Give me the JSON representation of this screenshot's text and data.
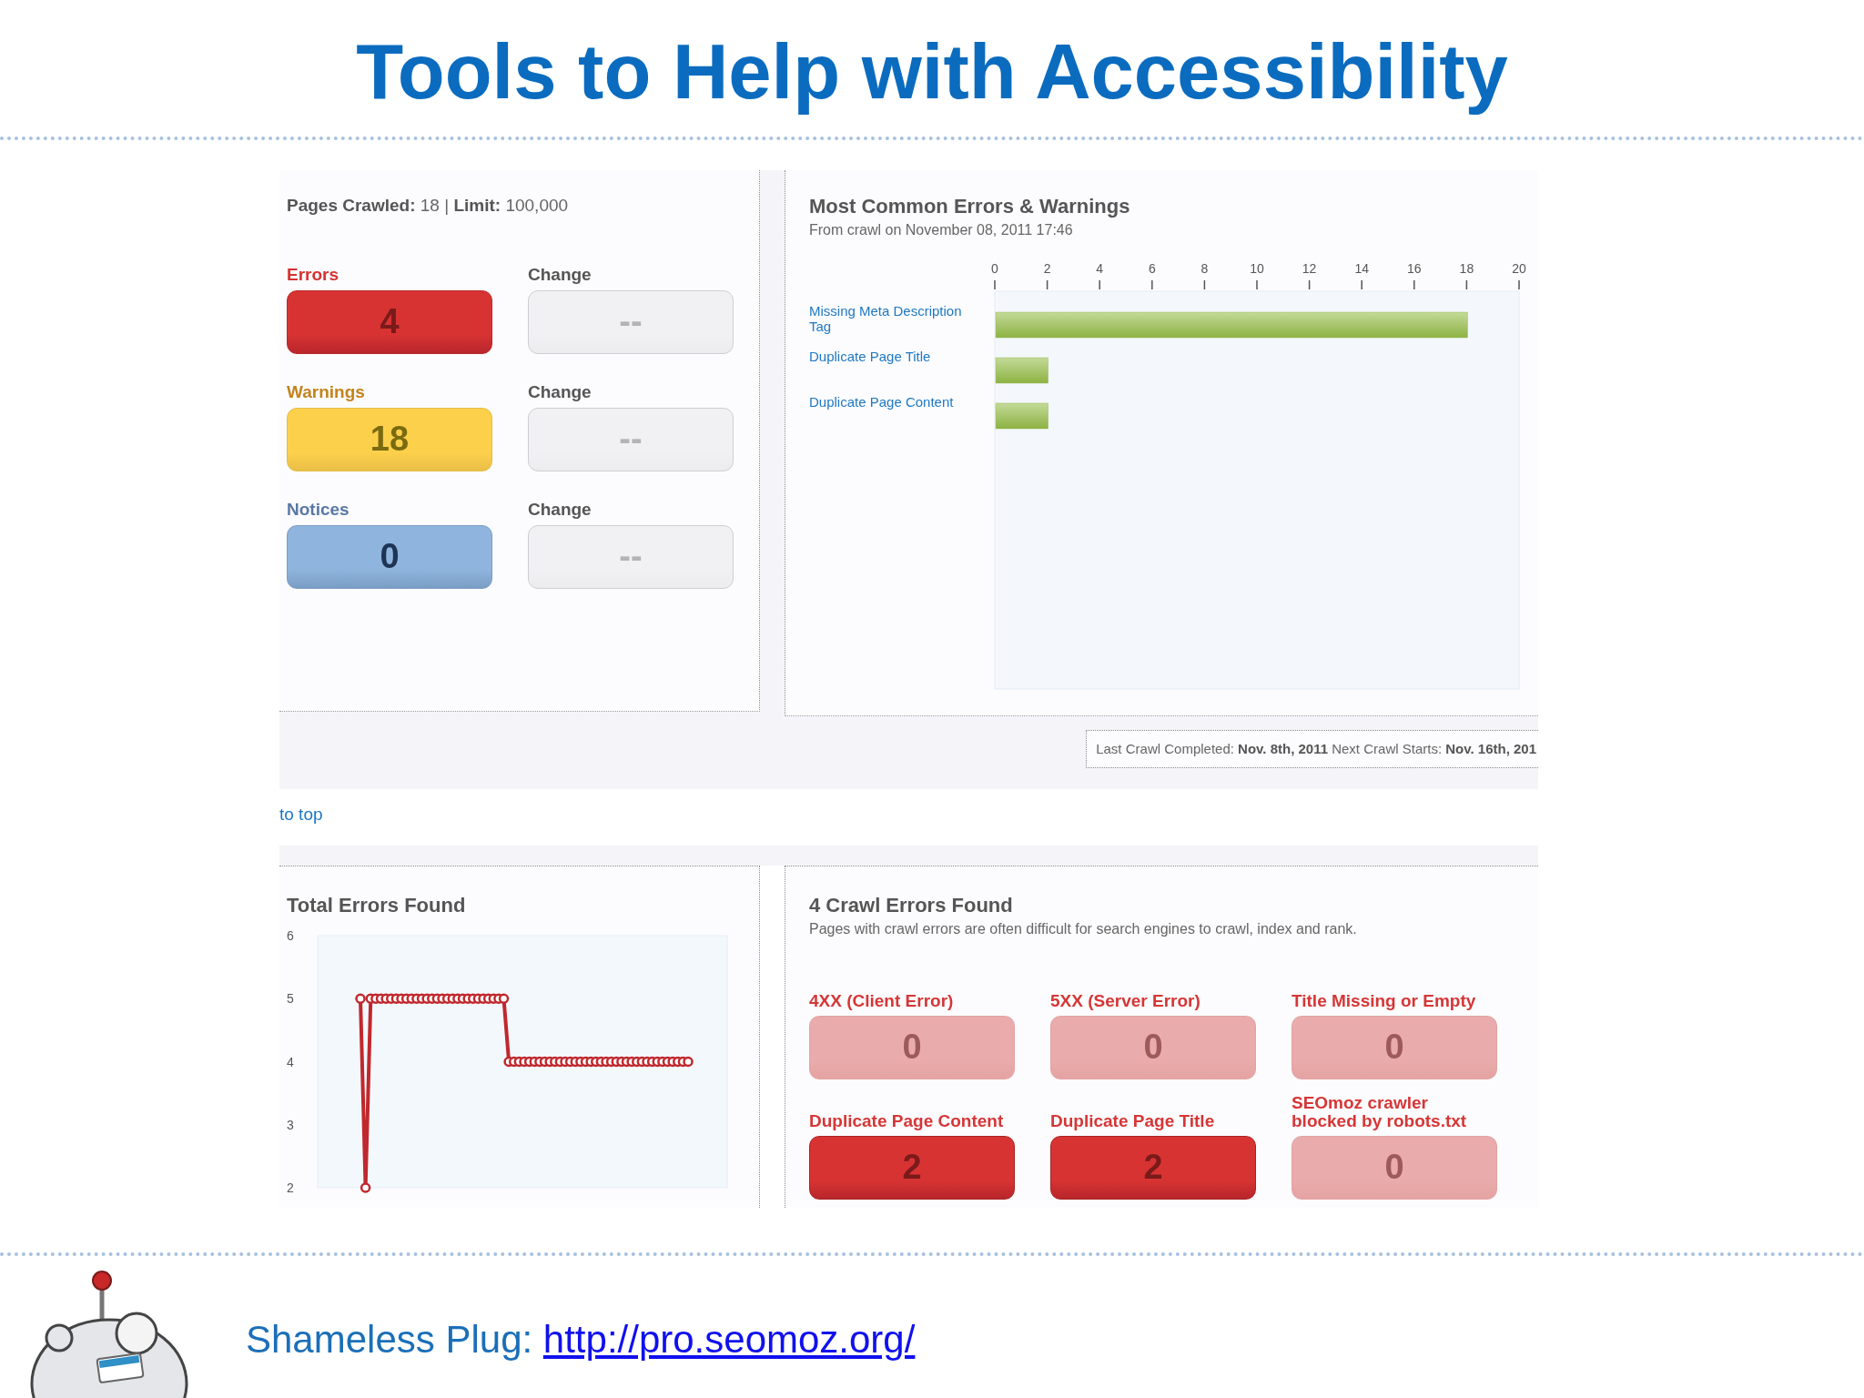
{
  "slide": {
    "title": "Tools to Help with Accessibility"
  },
  "summary": {
    "pages_crawled": "**Pages Crawled:** 18 | **Limit:** 100,000",
    "stats": [
      {
        "kind": "error",
        "label": "Errors",
        "value": "4",
        "color": "#d83333",
        "change_label": "Change",
        "change_value": "--"
      },
      {
        "kind": "warning",
        "label": "Warnings",
        "value": "18",
        "color": "#fdd04c",
        "change_label": "Change",
        "change_value": "--"
      },
      {
        "kind": "notice",
        "label": "Notices",
        "value": "0",
        "color": "#8fb5de",
        "change_label": "Change",
        "change_value": "--"
      }
    ]
  },
  "errors_chart": {
    "subtitle": "From crawl on November 08, 2011 17:46",
    "chart_data": {
      "type": "bar",
      "orientation": "horizontal",
      "title": "Most Common Errors & Warnings",
      "categories": [
        "Missing Meta Description Tag",
        "Duplicate Page Title",
        "Duplicate Page Content"
      ],
      "values": [
        18,
        2,
        2
      ],
      "xlim": [
        0,
        20
      ],
      "xticks": [
        0,
        2,
        4,
        6,
        8,
        10,
        12,
        14,
        16,
        18,
        20
      ]
    }
  },
  "crawl_status": "Last Crawl Completed: **Nov. 8th, 2011** Next Crawl Starts: **Nov. 16th, 201**",
  "back_to_top": "to top",
  "total_errors": {
    "chart_data": {
      "type": "line",
      "title": "Total Errors Found",
      "ylim": [
        2,
        6
      ],
      "yticks": [
        2,
        3,
        4,
        5,
        6
      ],
      "series": [
        {
          "color": "#c0282d",
          "marker": "circle",
          "values": [
            5,
            2,
            5,
            5,
            5,
            5,
            5,
            5,
            5,
            5,
            5,
            5,
            5,
            5,
            5,
            5,
            5,
            5,
            5,
            5,
            5,
            5,
            5,
            5,
            5,
            5,
            5,
            5,
            5,
            4,
            4,
            4,
            4,
            4,
            4,
            4,
            4,
            4,
            4,
            4,
            4,
            4,
            4,
            4,
            4,
            4,
            4,
            4,
            4,
            4,
            4,
            4,
            4,
            4,
            4,
            4,
            4,
            4,
            4,
            4,
            4,
            4,
            4,
            4,
            4
          ]
        }
      ]
    }
  },
  "crawl_errors": {
    "title": "4 Crawl Errors Found",
    "subtitle": "Pages with crawl errors are often difficult for search engines to crawl, index and rank.",
    "tiles": [
      {
        "label": "4XX (Client Error)",
        "value": "0",
        "active": false
      },
      {
        "label": "5XX (Server Error)",
        "value": "0",
        "active": false
      },
      {
        "label": "Title Missing or Empty",
        "value": "0",
        "active": false
      },
      {
        "label": "Duplicate Page Content",
        "value": "2",
        "active": true
      },
      {
        "label": "Duplicate Page Title",
        "value": "2",
        "active": true
      },
      {
        "label": "SEOmoz crawler blocked by robots.txt",
        "value": "0",
        "active": false
      }
    ]
  },
  "footer": {
    "label": "Shameless Plug:",
    "link": "http://pro.seomoz.org/"
  }
}
